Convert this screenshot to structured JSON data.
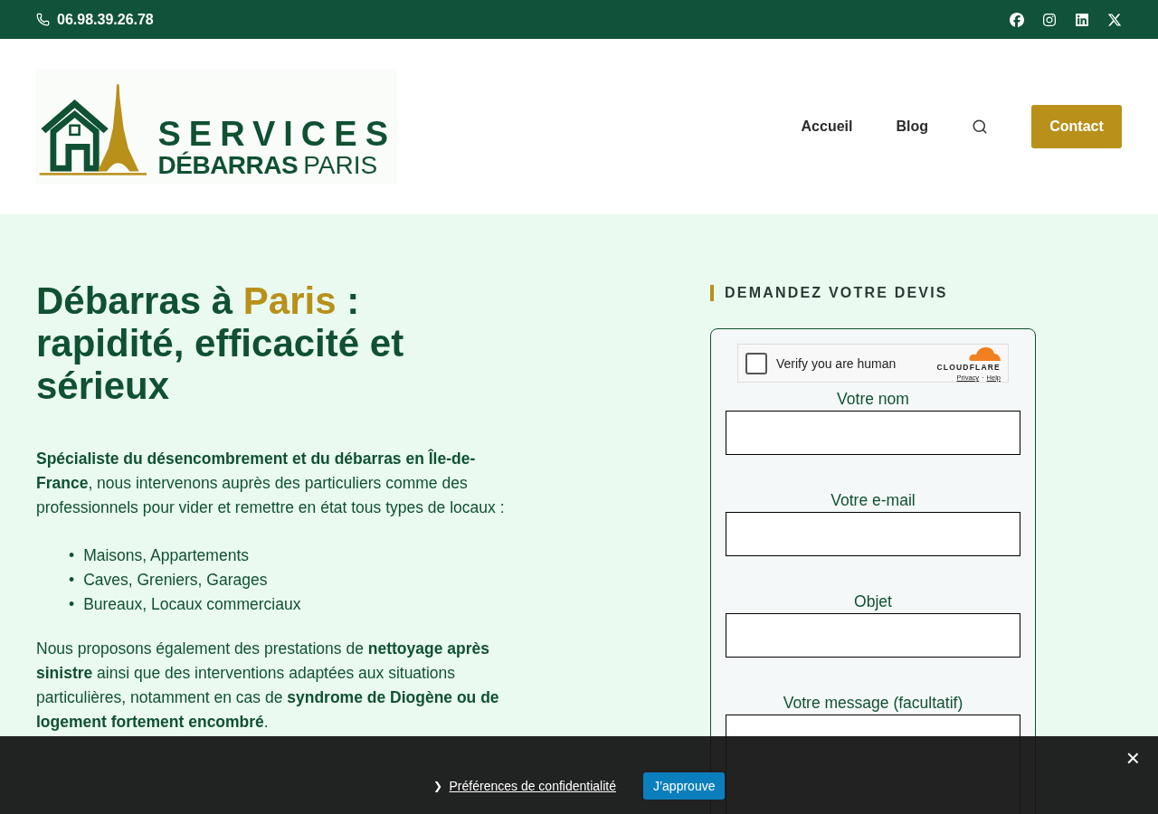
{
  "top_bar": {
    "phone": "06.98.39.26.78",
    "social": [
      {
        "kind": "facebook"
      },
      {
        "kind": "instagram"
      },
      {
        "kind": "linkedin"
      },
      {
        "kind": "x"
      }
    ]
  },
  "header": {
    "logo": {
      "line_1": "SERVICES",
      "line_2_bold": "DÉBARRAS",
      "line_2_light": "PARIS"
    },
    "nav": [
      {
        "label": "Accueil"
      },
      {
        "label": "Blog"
      }
    ],
    "contact_button": "Contact"
  },
  "hero": {
    "heading": [
      {
        "text": "Débarras à ",
        "highlight": false
      },
      {
        "text": "Paris",
        "highlight": true
      },
      {
        "text": " : rapidité, efficacité et sérieux",
        "highlight": false
      }
    ],
    "intro": "**Spécialiste du désencombrement et du débarras en Île-de-France**, nous intervenons auprès des particuliers comme des professionnels pour vider et remettre en état tous types de locaux :",
    "list_marker": "•",
    "list": [
      "Maisons, Appartements",
      "Caves, Greniers, Garages",
      "Bureaux, Locaux commerciaux"
    ],
    "paragraphs": [
      "Nous proposons également des prestations de **nettoyage après sinistre** ainsi que des interventions adaptées aux situations particulières, notamment en cas de **syndrome de Diogène ou de logement fortement encombré**."
    ]
  },
  "quote_form": {
    "title": "DEMANDEZ VOTRE DEVIS",
    "captcha": {
      "label": "Verify you are human",
      "checked": false,
      "brand": "CLOUDFLARE",
      "links": [
        "Privacy",
        "Help"
      ],
      "separator": "·"
    },
    "fields": [
      {
        "label": "Votre nom",
        "kind": "input"
      },
      {
        "label": "Votre e-mail",
        "kind": "input"
      },
      {
        "label": "Objet",
        "kind": "input"
      },
      {
        "label": "Votre message (facultatif)",
        "kind": "textarea"
      }
    ]
  },
  "cookie_bar": {
    "preferences_link": "Préférences de confidentialité",
    "chevron": "❯",
    "accept_button": "J’approuve",
    "close": "×"
  }
}
